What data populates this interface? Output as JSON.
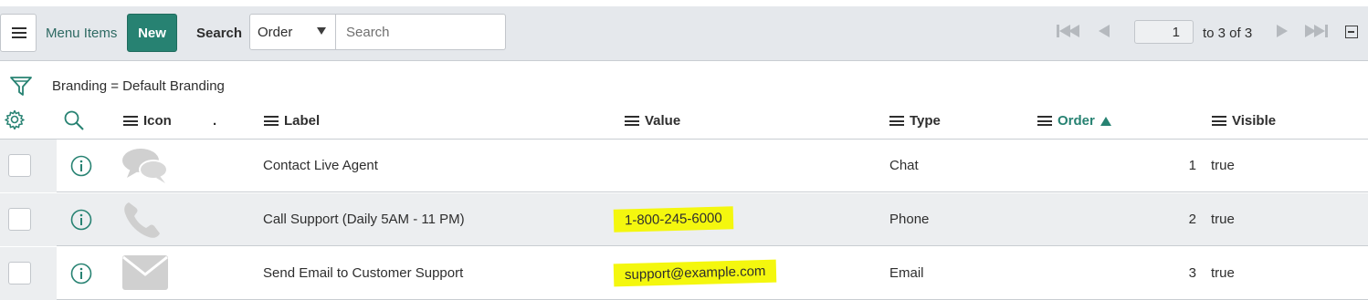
{
  "header": {
    "menu_label": "Menu Items",
    "new_label": "New",
    "search_label": "Search",
    "search_field": "Order",
    "search_placeholder": "Search",
    "page_current": "1",
    "page_info": "to 3 of 3"
  },
  "filter": {
    "text": "Branding = Default Branding"
  },
  "columns": {
    "dot": ".",
    "icon": "Icon",
    "label": "Label",
    "value": "Value",
    "type": "Type",
    "order": "Order",
    "visible": "Visible"
  },
  "rows": [
    {
      "icon": "chat-bubbles-icon",
      "label": "Contact Live Agent",
      "value": "",
      "type": "Chat",
      "order": "1",
      "visible": "true"
    },
    {
      "icon": "phone-icon",
      "label": "Call Support (Daily 5AM - 11 PM)",
      "value": "1-800-245-6000",
      "type": "Phone",
      "order": "2",
      "visible": "true"
    },
    {
      "icon": "envelope-icon",
      "label": "Send Email to Customer Support",
      "value": "support@example.com",
      "type": "Email",
      "order": "3",
      "visible": "true"
    }
  ],
  "colors": {
    "accent": "#278272",
    "highlight": "#f4f70e",
    "header_bg": "#e5e8ec"
  }
}
